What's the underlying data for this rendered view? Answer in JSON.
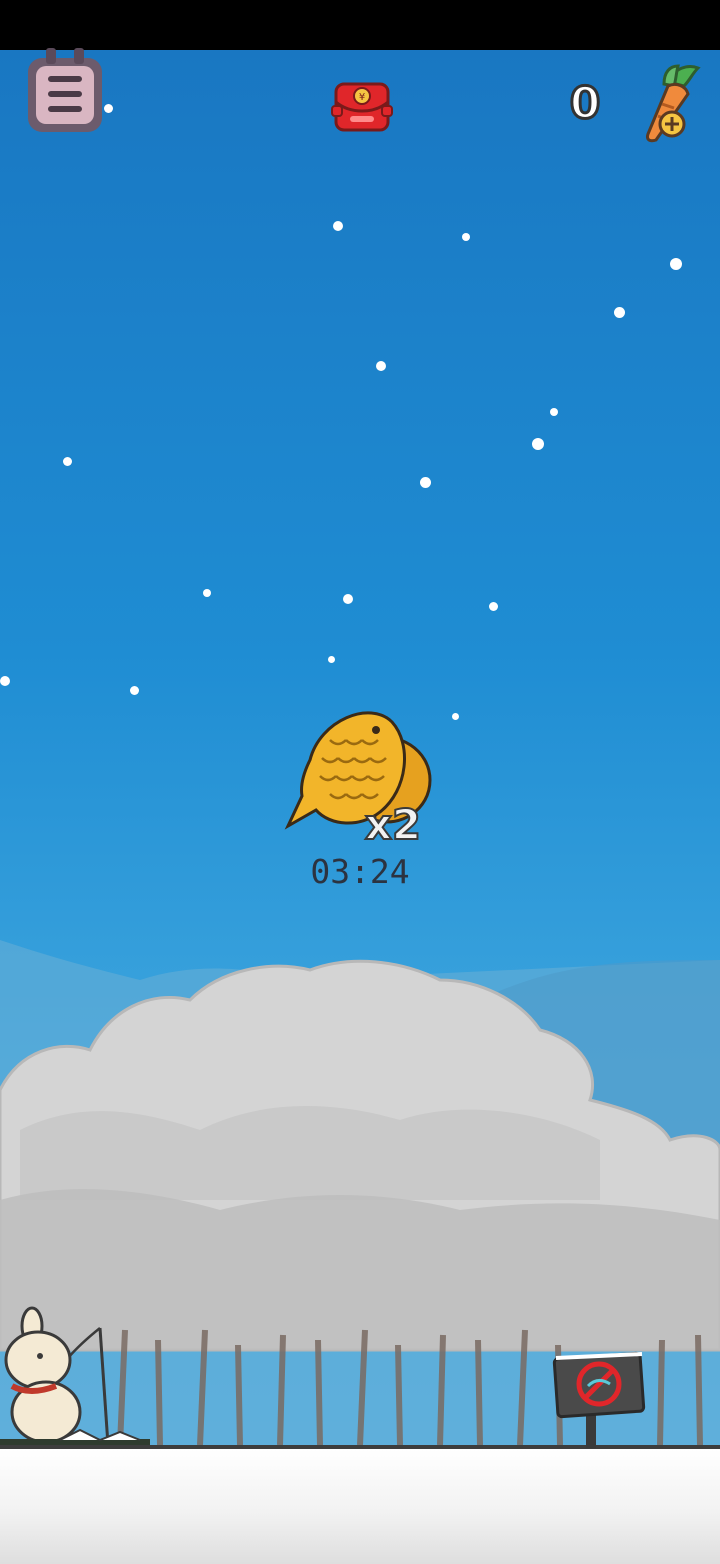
{
  "hud": {
    "menu_icon": "menu-list-icon",
    "red_envelope_icon": "red-envelope-icon",
    "coin_count": "0",
    "carrot_icon": "carrot-add-icon"
  },
  "bonus": {
    "item_icon": "taiyaki-fish-icon",
    "multiplier": "x2",
    "timer": "03:24"
  },
  "scene": {
    "character": "rabbit-fishing",
    "sign_icon": "no-fishing-sign-icon"
  },
  "colors": {
    "sky_top": "#1977c2",
    "sky_bottom": "#5ab4e4",
    "taiyaki": "#f2b52a",
    "envelope": "#e0262a"
  }
}
